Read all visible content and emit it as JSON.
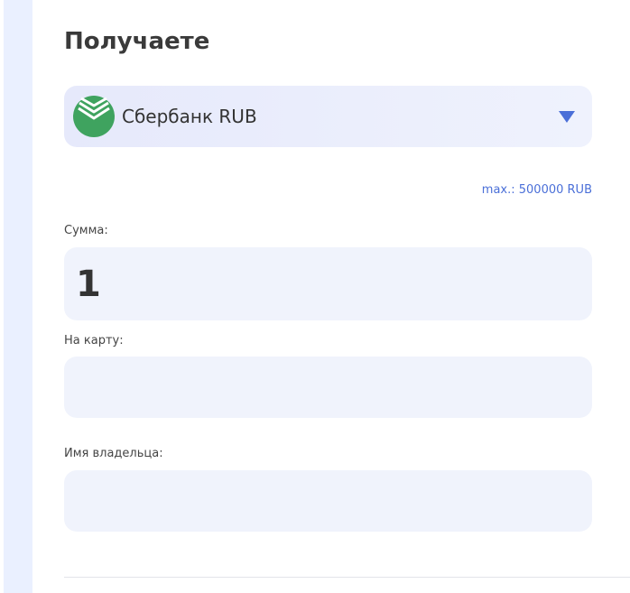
{
  "header": {
    "title": "Получаете"
  },
  "bank_select": {
    "selected": "Сбербанк RUB",
    "icon": "sberbank-logo-icon",
    "arrow_icon": "triangle-down-icon",
    "accent_color": "#4a6fd8"
  },
  "limits": {
    "max": "max.: 500000 RUB"
  },
  "form": {
    "amount_label": "Сумма:",
    "amount_value": "1",
    "card_label": "На карту:",
    "card_value": "",
    "owner_label": "Имя владельца:",
    "owner_value": ""
  },
  "colors": {
    "brand_green": "#3fa35f",
    "field_bg": "#f0f3fc",
    "side_strip": "#eaf0ff"
  }
}
